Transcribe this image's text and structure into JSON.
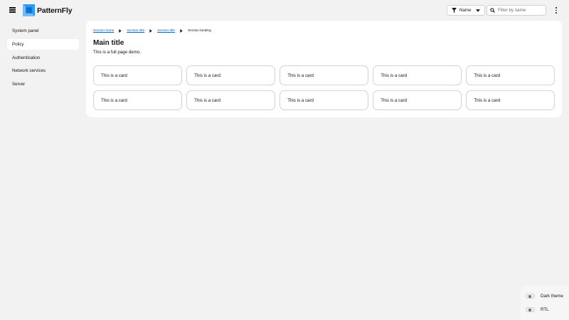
{
  "header": {
    "brand": "PatternFly",
    "filter": {
      "selected": "Name"
    },
    "search": {
      "placeholder": "Filter by name",
      "value": ""
    }
  },
  "sidebar": {
    "items": [
      {
        "label": "System panel",
        "active": false
      },
      {
        "label": "Policy",
        "active": true
      },
      {
        "label": "Authentication",
        "active": false
      },
      {
        "label": "Network services",
        "active": false
      },
      {
        "label": "Server",
        "active": false
      }
    ]
  },
  "main": {
    "breadcrumb": {
      "items": [
        "Section home",
        "Section title",
        "Section title"
      ],
      "current": "Section landing"
    },
    "title": "Main title",
    "description": "This is a full page demo.",
    "cards": [
      "This is a card",
      "This is a card",
      "This is a card",
      "This is a card",
      "This is a card",
      "This is a card",
      "This is a card",
      "This is a card",
      "This is a card",
      "This is a card"
    ]
  },
  "toggles": {
    "dark_theme": {
      "label": "Dark theme",
      "on": false
    },
    "rtl": {
      "label": "RTL",
      "on": false
    }
  },
  "colors": {
    "background": "#f2f2f2",
    "panel": "#ffffff",
    "link": "#0066cc",
    "border": "#d2d2d2",
    "text": "#151515"
  },
  "icons": [
    "hamburger-icon",
    "patternfly-logo-icon",
    "filter-icon",
    "caret-down-icon",
    "search-icon",
    "kebab-icon",
    "chevron-right-icon"
  ]
}
